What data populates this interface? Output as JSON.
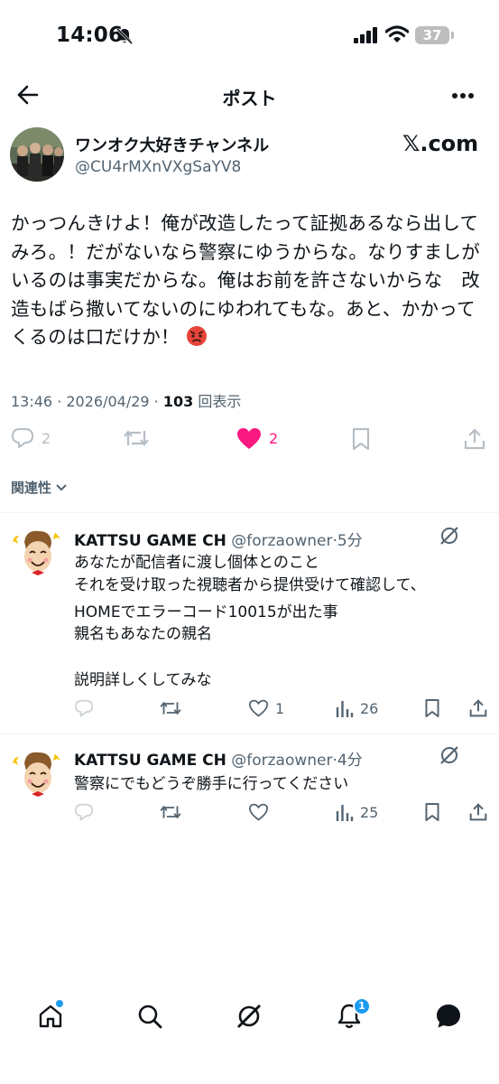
{
  "status_bar": {
    "time": "14:06",
    "battery": "37"
  },
  "header": {
    "title": "ポスト"
  },
  "post": {
    "author_name": "ワンオク大好きチャンネル",
    "author_handle": "@CU4rMXnVXgSaYV8",
    "badge_text": "𝕏.com",
    "text": "かっつんきけよ！俺が改造したって証拠あるなら出してみろ。！だがないなら警察にゆうからな。なりすましがいるのは事実だからな。俺はお前を許さないからな　改造もばら撒いてないのにゆわれてもな。あと、かかってくるのは口だけか！",
    "time": "13:46",
    "date": "2026/04/29",
    "views": "103",
    "views_suffix": "回表示",
    "replies": "2",
    "likes": "2"
  },
  "sort": {
    "label": "関連性"
  },
  "replies": [
    {
      "name": "KATTSU GAME CH",
      "handle": "@forzaowner",
      "time": "5分",
      "lines": [
        "あなたが配信者に渡し個体とのこと",
        "それを受け取った視聴者から提供受けて確認して、",
        "HOMEでエラーコード10015が出た事",
        "親名もあなたの親名",
        "",
        "説明詳しくしてみな"
      ],
      "likes": "1",
      "views": "26"
    },
    {
      "name": "KATTSU GAME CH",
      "handle": "@forzaowner",
      "time": "4分",
      "lines": [
        "警察にでもどうぞ勝手に行ってください"
      ],
      "likes": "",
      "views": "25"
    }
  ],
  "bottom_nav": {
    "notifications_count": "1"
  },
  "colors": {
    "accent": "#1d9bf0",
    "like": "#f91880",
    "muted": "#536471",
    "divider": "#eff3f4"
  }
}
